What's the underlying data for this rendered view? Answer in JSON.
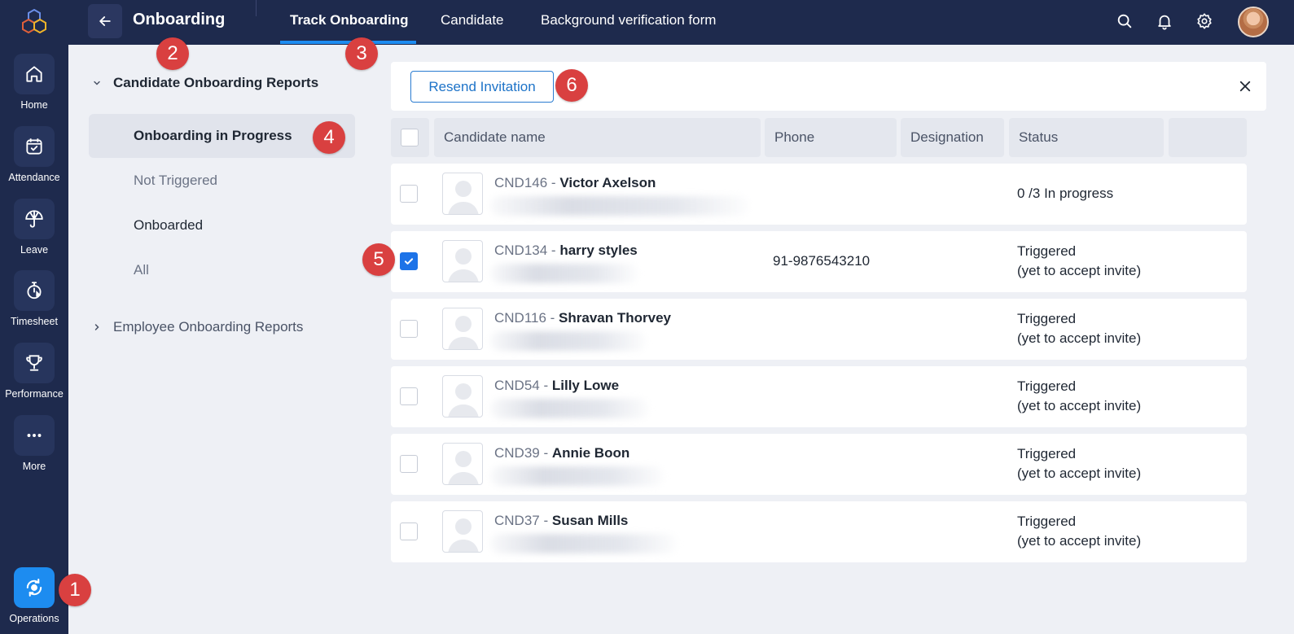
{
  "rail": {
    "items": [
      {
        "label": "Home",
        "icon": "home-icon"
      },
      {
        "label": "Attendance",
        "icon": "calendar-check-icon"
      },
      {
        "label": "Leave",
        "icon": "umbrella-icon"
      },
      {
        "label": "Timesheet",
        "icon": "stopwatch-icon"
      },
      {
        "label": "Performance",
        "icon": "trophy-icon"
      },
      {
        "label": "More",
        "icon": "more-dots-icon"
      }
    ],
    "active": {
      "label": "Operations",
      "icon": "operations-icon"
    }
  },
  "header": {
    "title": "Onboarding",
    "tabs": [
      {
        "label": "Track Onboarding",
        "active": true
      },
      {
        "label": "Candidate",
        "active": false
      },
      {
        "label": "Background verification form",
        "active": false
      }
    ],
    "icons": [
      "search-icon",
      "bell-icon",
      "gear-icon",
      "user-avatar"
    ]
  },
  "reports": {
    "candidate_section": "Candidate Onboarding Reports",
    "items": [
      "Onboarding in Progress",
      "Not Triggered",
      "Onboarded",
      "All"
    ],
    "active_item": "Onboarding in Progress",
    "employee_section": "Employee Onboarding Reports"
  },
  "toolbar": {
    "resend_label": "Resend Invitation"
  },
  "table": {
    "columns": [
      "Candidate name",
      "Phone",
      "Designation",
      "Status"
    ],
    "rows": [
      {
        "id": "CND146",
        "name": "Victor Axelson",
        "phone": "",
        "designation": "",
        "status_line1": "0 /3 In progress",
        "status_line2": "",
        "checked": false
      },
      {
        "id": "CND134",
        "name": "harry styles",
        "phone": "91-9876543210",
        "designation": "",
        "status_line1": "Triggered",
        "status_line2": "(yet to accept invite)",
        "checked": true
      },
      {
        "id": "CND116",
        "name": "Shravan Thorvey",
        "phone": "",
        "designation": "",
        "status_line1": "Triggered",
        "status_line2": "(yet to accept invite)",
        "checked": false
      },
      {
        "id": "CND54",
        "name": "Lilly Lowe",
        "phone": "",
        "designation": "",
        "status_line1": "Triggered",
        "status_line2": "(yet to accept invite)",
        "checked": false
      },
      {
        "id": "CND39",
        "name": "Annie Boon",
        "phone": "",
        "designation": "",
        "status_line1": "Triggered",
        "status_line2": "(yet to accept invite)",
        "checked": false
      },
      {
        "id": "CND37",
        "name": "Susan Mills",
        "phone": "",
        "designation": "",
        "status_line1": "Triggered",
        "status_line2": "(yet to accept invite)",
        "checked": false
      }
    ]
  },
  "callouts": [
    "1",
    "2",
    "3",
    "4",
    "5",
    "6"
  ],
  "colors": {
    "nav_bg": "#1e2a4d",
    "accent": "#1d8cf0",
    "callout": "#d94040",
    "page_bg": "#eef0f5"
  }
}
